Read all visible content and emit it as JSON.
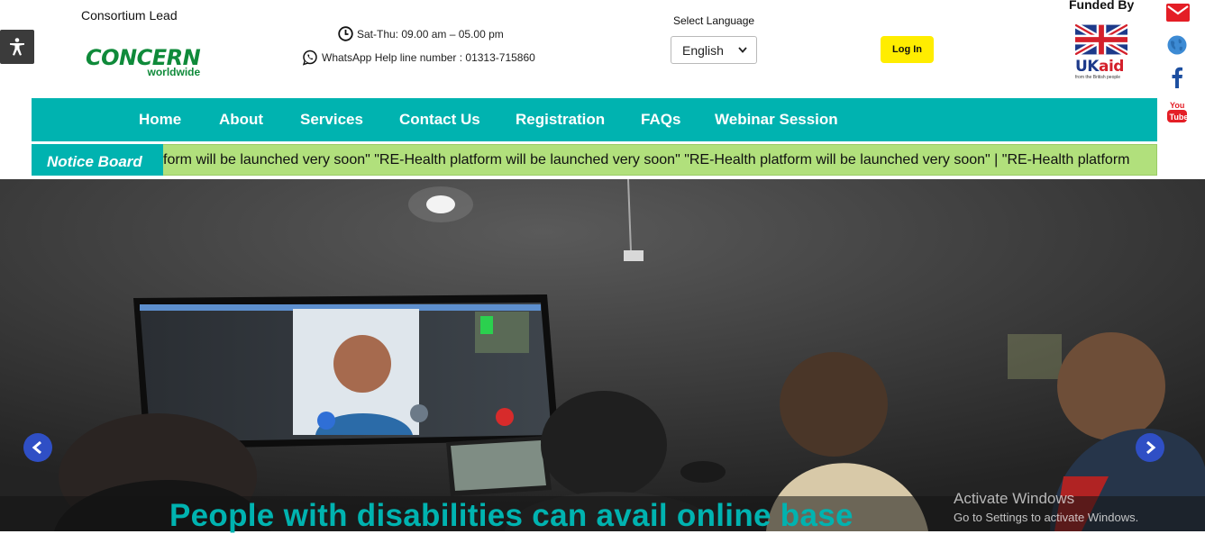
{
  "header": {
    "consortium_label": "Consortium Lead",
    "concern_logo_main": "CONCERN",
    "concern_logo_sub": "worldwide",
    "hours": "Sat-Thu: 09.00 am – 05.00 pm",
    "whatsapp": "WhatsApp Help line number : 01313-715860",
    "select_language_label": "Select Language",
    "language_value": "English",
    "login_label": "Log In",
    "funded_by_label": "Funded By",
    "ukaid_uk": "UK",
    "ukaid_aid": "aid",
    "ukaid_tagline": "from the British people"
  },
  "nav": {
    "items": [
      {
        "label": "Home"
      },
      {
        "label": "About"
      },
      {
        "label": "Services"
      },
      {
        "label": "Contact Us"
      },
      {
        "label": "Registration"
      },
      {
        "label": "FAQs"
      },
      {
        "label": "Webinar Session"
      }
    ]
  },
  "notice": {
    "label": "Notice Board",
    "ticker_text": "form will be launched very soon\" \"RE-Health platform will be launched very soon\" \"RE-Health platform will be launched very soon\" |        \"RE-Health platform"
  },
  "hero": {
    "caption": "People with disabilities can avail online base"
  },
  "os_overlay": {
    "title": "Activate Windows",
    "subtitle": "Go to Settings to activate Windows."
  },
  "colors": {
    "teal": "#00b3b0",
    "notice_green": "#b1e07c",
    "login_yellow": "#ffed00",
    "arrow_blue": "#2f4fc5"
  },
  "icons": [
    "accessibility-icon",
    "clock-icon",
    "whatsapp-icon",
    "chevron-down-icon",
    "mail-icon",
    "globe-icon",
    "facebook-icon",
    "youtube-icon",
    "chevron-left-icon",
    "chevron-right-icon"
  ]
}
